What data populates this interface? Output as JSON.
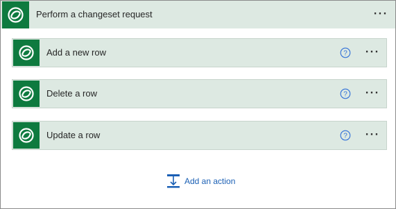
{
  "scope": {
    "title": "Perform a changeset request",
    "more_label": "···",
    "icon": "dataverse-icon"
  },
  "actions": [
    {
      "title": "Add a new row",
      "icon": "dataverse-icon",
      "help_label": "?",
      "more_label": "···"
    },
    {
      "title": "Delete a row",
      "icon": "dataverse-icon",
      "help_label": "?",
      "more_label": "···"
    },
    {
      "title": "Update a row",
      "icon": "dataverse-icon",
      "help_label": "?",
      "more_label": "···"
    }
  ],
  "add_action": {
    "label": "Add an action",
    "icon": "add-action-icon"
  },
  "colors": {
    "header_bg": "#dde9e2",
    "icon_bg": "#0e7a3f",
    "link": "#1a5fb4",
    "help": "#2f6fd8"
  }
}
